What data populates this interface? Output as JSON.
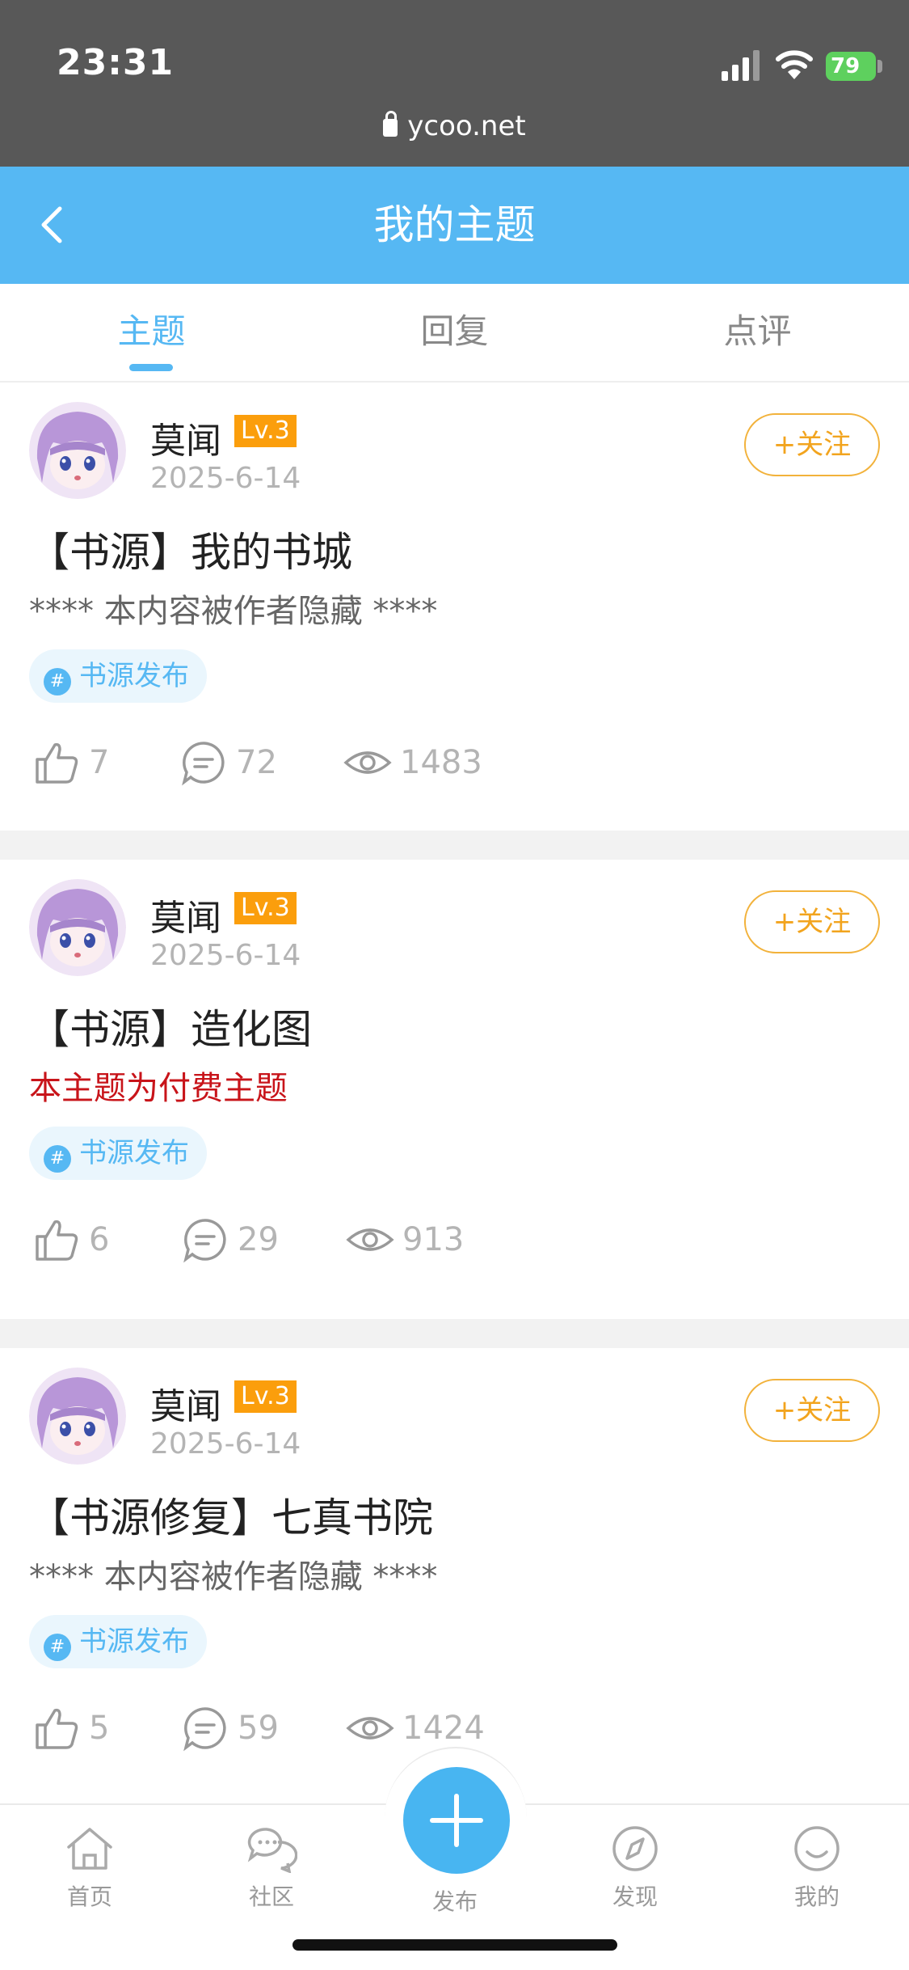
{
  "status_bar": {
    "time": "23:31",
    "battery": "79"
  },
  "browser": {
    "url": "ycoo.net"
  },
  "header": {
    "title": "我的主题"
  },
  "tabs": [
    {
      "label": "主题",
      "active": true
    },
    {
      "label": "回复",
      "active": false
    },
    {
      "label": "点评",
      "active": false
    }
  ],
  "posts": [
    {
      "author": "莫闻",
      "level": "Lv.3",
      "date": "2025-6-14",
      "follow_label": "+关注",
      "title": "【书源】我的书城",
      "excerpt": "**** 本内容被作者隐藏 ****",
      "excerpt_paid": false,
      "tag": "书源发布",
      "likes": "7",
      "comments": "72",
      "views": "1483"
    },
    {
      "author": "莫闻",
      "level": "Lv.3",
      "date": "2025-6-14",
      "follow_label": "+关注",
      "title": "【书源】造化图",
      "excerpt": "本主题为付费主题",
      "excerpt_paid": true,
      "tag": "书源发布",
      "likes": "6",
      "comments": "29",
      "views": "913"
    },
    {
      "author": "莫闻",
      "level": "Lv.3",
      "date": "2025-6-14",
      "follow_label": "+关注",
      "title": "【书源修复】七真书院",
      "excerpt": "**** 本内容被作者隐藏 ****",
      "excerpt_paid": false,
      "tag": "书源发布",
      "likes": "5",
      "comments": "59",
      "views": "1424"
    }
  ],
  "bottom_nav": {
    "home": "首页",
    "community": "社区",
    "publish": "发布",
    "discover": "发现",
    "mine": "我的"
  },
  "colors": {
    "accent": "#56b8f3",
    "level_badge": "#fb9e0c",
    "follow": "#f2a41e",
    "paid": "#c8141a"
  }
}
